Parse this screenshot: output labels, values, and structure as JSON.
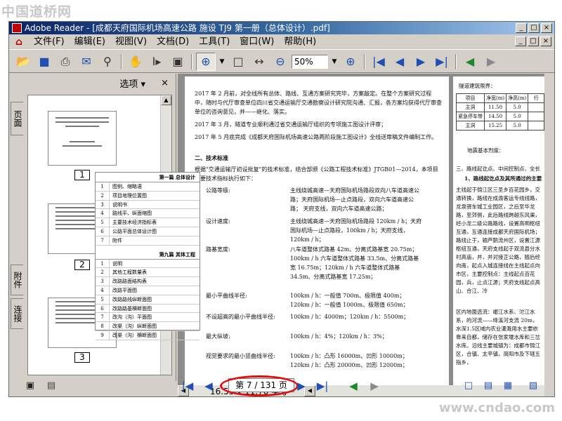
{
  "watermarks": {
    "top": "中国道桥网",
    "bottom": "www.cndao.com"
  },
  "window": {
    "title": "Adobe Reader - [成都天府国际机场高速公路 施设 TJ9 第一册（总体设计）.pdf]",
    "buttons": [
      "_",
      "□",
      "×"
    ]
  },
  "menu": {
    "items": [
      "文件(F)",
      "编辑(E)",
      "视图(V)",
      "文档(D)",
      "工具(T)",
      "窗口(W)",
      "帮助(H)"
    ]
  },
  "toolbar": {
    "zoom_value": "50%",
    "icons": [
      "open-icon",
      "save-icon",
      "print-icon",
      "email-icon",
      "search-icon",
      "hand-icon",
      "select-text-icon",
      "snapshot-icon",
      "zoom-in-icon",
      "fit-page-icon",
      "fit-width-icon",
      "zoom-out-icon",
      "zoom-in-plus-icon",
      "first-page-icon",
      "prev-page-icon",
      "next-page-icon",
      "last-page-icon",
      "back-icon",
      "forward-icon"
    ]
  },
  "left_tabs": {
    "pages": "页面",
    "attachments": "附件",
    "links": "连接"
  },
  "panel": {
    "options_label": "选项 ▾",
    "close": "×",
    "thumbnails": [
      {
        "num": "1"
      },
      {
        "num": "2"
      },
      {
        "num": "3"
      }
    ]
  },
  "toc": {
    "section1_title": "第一篇  总体设计",
    "section1_rows": [
      {
        "n": "1",
        "t": "图例、缩略语"
      },
      {
        "n": "2",
        "t": "项目地理位置图"
      },
      {
        "n": "3",
        "t": "说明书"
      },
      {
        "n": "4",
        "t": "路线平、纵面缩图"
      },
      {
        "n": "5",
        "t": "主要技术经济指标表"
      },
      {
        "n": "6",
        "t": "公路平面总体设计图"
      },
      {
        "n": "7",
        "t": "附件"
      }
    ],
    "section9_title": "第九篇  其体工程",
    "section9_rows": [
      {
        "n": "1",
        "t": "说明"
      },
      {
        "n": "2",
        "t": "其他工程数量表"
      },
      {
        "n": "3",
        "t": "改路路面结构表"
      },
      {
        "n": "4",
        "t": "改路平面图"
      },
      {
        "n": "5",
        "t": "改路路线纵断面图"
      },
      {
        "n": "6",
        "t": "改路路基横断面图"
      },
      {
        "n": "7",
        "t": "改沟（沟）平面图"
      },
      {
        "n": "8",
        "t": "改渠（沟）纵断面图"
      },
      {
        "n": "9",
        "t": "改渠（沟）横断面图"
      }
    ]
  },
  "document": {
    "p1": "2017 年 2 月前，对全线所有总体、路线、互通方案研究完毕，方案敲定。在整个方案研究过程中，随时与代厅审查单位四川省交通运输厅交通勘察设计研究院沟通、汇报，各方案均获得代厅审查单位的咨询意见，并——继化、落实。",
    "p2": "2017 年 3 月，隧道专业顺利通过省交通运输厅组织的专项施工图设计评审；",
    "p3": "2017 年 5 月底完成《成都天府国际机场高速公路两阶段施工图设计》全线送审稿文件编制工作。",
    "p4": "二、技术标准",
    "p5": "根据\"交通运输厅初设批复\"的技术标准，结合部颁《公路工程技术标准》JTGB01—2014，本项目主要技术指标执行如下：",
    "spec_labels": [
      "公路等级:",
      "设计速度:",
      "路基宽度:",
      "最小平曲线半径:",
      "不设超高的最小平曲线半径:",
      "最大纵坡:",
      "视觉要求的最小竖曲线半径:"
    ],
    "spec_values": [
      "主线绕城高速—天府国际机场路段双向八车道高速公路；天府国际机场—止点路段，双向六车道高速公路；  天府支线，双向六车道高速公路；",
      "主线绕城高速—天府国际机场路段 120km / h；天府国际机场—止点路段，100km / h；天府支线，120km / h；",
      "八车道整体式路基 42m、分离式路基宽 20.75m；100km / h 六车道整体式路基 33.5m、分离式路基宽 16.75m；120km / h 六车道整体式路基 34.5m、分离式路基宽 17.25m；",
      "100km / h：一般值 700m、极限值 400m；120km / h：一般值 1000m、极限值 650m；",
      "100km / h：4000m；120km / h：5500m；",
      "100km / h：4%；120km / h：3%；",
      "100km / h：凸形 16000m、凹形 10000m；120km / h：凸形 20000m、凹形 12000m；"
    ],
    "right_page": {
      "heading": "隧道建筑限界：",
      "table_header": [
        "项目",
        "净宽(m)",
        "净高(m)",
        "行"
      ],
      "table_rows": [
        [
          "主洞",
          "11.50",
          "5.0",
          ""
        ],
        [
          "紧急停车带",
          "14.50",
          "5.0",
          ""
        ],
        [
          "主洞",
          "15.25",
          "5.0",
          ""
        ]
      ],
      "line1": "地震基本烈度：",
      "line2": "三、路线起讫点、中间控制点、全长",
      "line3": "1、路线起讫点及其所通过的主要",
      "body": "主线起于锦江区三圣乡百花园乡，交通转换，路线在成渝客运专线线路，龙泉驿车城工业园区，之后至华龙路，至郊侧，此后路线跨越东风渠，经小龙二级公路路线，设置高明枢纽互通，互通连接成都天府国际机场；路线止于，输芦鹅流州区，设置江源枢纽互通，天府支线起于双流县分水村高庙，并，并对接正公路，随后经向南，起点入城连接线在主线起点向市区，主要控制点：主线起点百花园，兵，止点江源；天府支线起点高山、合江、冷",
      "body2": "区内地面选流：岷江水系、沱江水系，的河流——绛溪河支流 20m，水深1.5区域内农业灌溉用水主要依靠来自都，储存在张家堰水库和三岔水库。沿线主要城镇为：成都市锦江区，合镇、太平镇，简阳市及下辖五指乡，"
    }
  },
  "hscroll": {
    "page_size": "16.55 x 11.70 英寸"
  },
  "status": {
    "page_indicator": "第 7 / 131 页"
  }
}
